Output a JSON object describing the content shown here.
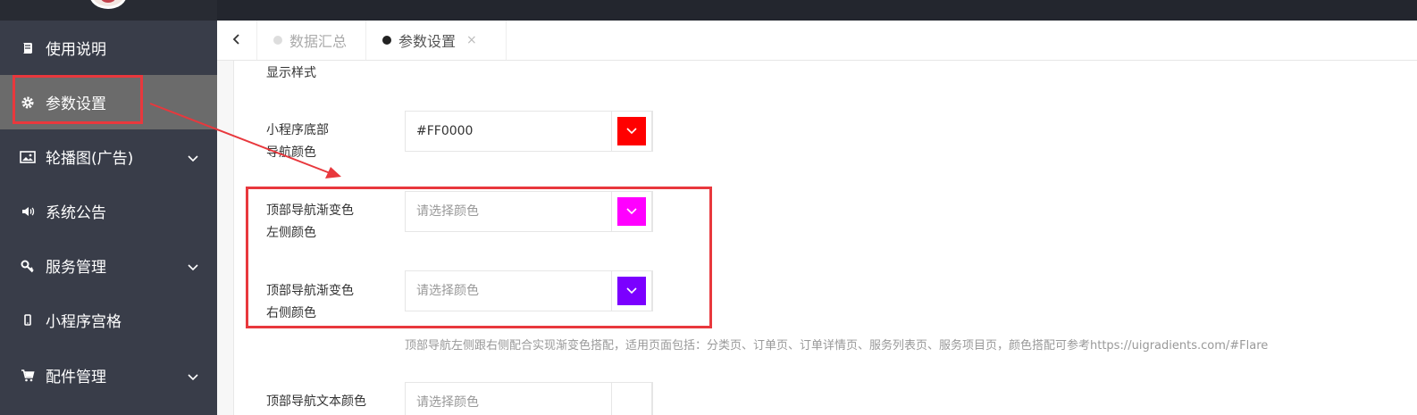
{
  "sidebar": {
    "items": [
      {
        "label": "使用说明",
        "icon": "book-icon",
        "expandable": false
      },
      {
        "label": "参数设置",
        "icon": "gear-icon",
        "expandable": false,
        "active": true
      },
      {
        "label": "轮播图(广告)",
        "icon": "image-icon",
        "expandable": true
      },
      {
        "label": "系统公告",
        "icon": "megaphone-icon",
        "expandable": false
      },
      {
        "label": "服务管理",
        "icon": "key-icon",
        "expandable": true
      },
      {
        "label": "小程序宫格",
        "icon": "mobile-icon",
        "expandable": false
      },
      {
        "label": "配件管理",
        "icon": "cart-icon",
        "expandable": true
      }
    ]
  },
  "tabs": [
    {
      "label": "数据汇总",
      "active": false
    },
    {
      "label": "参数设置",
      "active": true,
      "close": "×"
    }
  ],
  "form": {
    "section_label": "显示样式",
    "rows": [
      {
        "label_line1": "小程序底部",
        "label_line2": "导航颜色",
        "value": "#FF0000",
        "placeholder": "",
        "swatch_color": "#ff0000"
      },
      {
        "label_line1": "顶部导航渐变色",
        "label_line2": "左侧颜色",
        "value": "",
        "placeholder": "请选择颜色",
        "swatch_color": "#ff00ff"
      },
      {
        "label_line1": "顶部导航渐变色",
        "label_line2": "右侧颜色",
        "value": "",
        "placeholder": "请选择颜色",
        "swatch_color": "#7b00ff"
      },
      {
        "label_line1": "顶部导航文本颜色",
        "label_line2": "",
        "value": "",
        "placeholder": "请选择颜色",
        "swatch_color": "#ffffff"
      }
    ],
    "hint": "顶部导航左侧跟右侧配合实现渐变色搭配，适用页面包括：分类页、订单页、订单详情页、服务列表页、服务项目页，颜色搭配可参考https://uigradients.com/#Flare"
  },
  "colors": {
    "sidebar_bg": "#393d49",
    "sidebar_active": "#6b6b6b",
    "annotation": "#e8383d"
  }
}
